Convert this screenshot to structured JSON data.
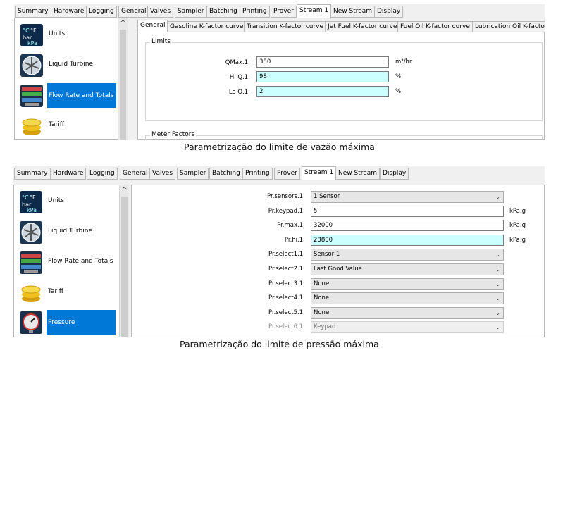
{
  "screen1": {
    "tabs": [
      "Summary",
      "Hardware",
      "Logging",
      "General",
      "Valves",
      "Sampler",
      "Batching",
      "Printing",
      "Prover",
      "Stream 1",
      "New Stream",
      "Display"
    ],
    "sidebar": [
      {
        "label": "Units",
        "icon": "units-icon"
      },
      {
        "label": "Liquid Turbine",
        "icon": "turbine-icon"
      },
      {
        "label": "Flow Rate and Totals",
        "icon": "flow-rate-icon"
      },
      {
        "label": "Tariff",
        "icon": "coins-icon"
      }
    ],
    "subtabs": [
      "General",
      "Gasoline K-factor curve",
      "Transition K-factor curve",
      "Jet Fuel K-factor curve",
      "Fuel Oil K-factor curve",
      "Lubrication Oil K-factor"
    ],
    "group_limits": "Limits",
    "group_meter": "Meter Factors",
    "fields": [
      {
        "label": "QMax.1:",
        "value": "380",
        "unit": "m³/hr"
      },
      {
        "label": "Hi Q.1:",
        "value": "98",
        "unit": "%"
      },
      {
        "label": "Lo Q.1:",
        "value": "2",
        "unit": "%"
      }
    ],
    "caption": "Parametrização do limite de vazão máxima"
  },
  "screen2": {
    "tabs": [
      "Summary",
      "Hardware",
      "Logging",
      "General",
      "Valves",
      "Sampler",
      "Batching",
      "Printing",
      "Prover",
      "Stream 1",
      "New Stream",
      "Display"
    ],
    "sidebar": [
      {
        "label": "Units",
        "icon": "units-icon"
      },
      {
        "label": "Liquid Turbine",
        "icon": "turbine-icon"
      },
      {
        "label": "Flow Rate and Totals",
        "icon": "flow-rate-icon"
      },
      {
        "label": "Tariff",
        "icon": "coins-icon"
      },
      {
        "label": "Pressure",
        "icon": "pressure-gauge-icon"
      }
    ],
    "rows": [
      {
        "label": "Pr.sensors.1:",
        "value": "1 Sensor",
        "type": "select",
        "unit": ""
      },
      {
        "label": "Pr.keypad.1:",
        "value": "5",
        "type": "input",
        "unit": "kPa.g"
      },
      {
        "label": "Pr.max.1:",
        "value": "32000",
        "type": "input",
        "unit": "kPa.g"
      },
      {
        "label": "Pr.hi.1:",
        "value": "28800",
        "type": "input-cyan",
        "unit": "kPa.g"
      },
      {
        "label": "Pr.select1.1:",
        "value": "Sensor 1",
        "type": "select",
        "unit": ""
      },
      {
        "label": "Pr.select2.1:",
        "value": "Last Good Value",
        "type": "select",
        "unit": ""
      },
      {
        "label": "Pr.select3.1:",
        "value": "None",
        "type": "select",
        "unit": ""
      },
      {
        "label": "Pr.select4.1:",
        "value": "None",
        "type": "select",
        "unit": ""
      },
      {
        "label": "Pr.select5.1:",
        "value": "None",
        "type": "select",
        "unit": ""
      },
      {
        "label": "Pr.select6.1:",
        "value": "Keypad",
        "type": "select-disabled",
        "unit": ""
      }
    ],
    "caption": "Parametrização do limite de pressão máxima"
  },
  "colors": {
    "selection": "#0078d7",
    "highlight_field": "#ccffff"
  }
}
